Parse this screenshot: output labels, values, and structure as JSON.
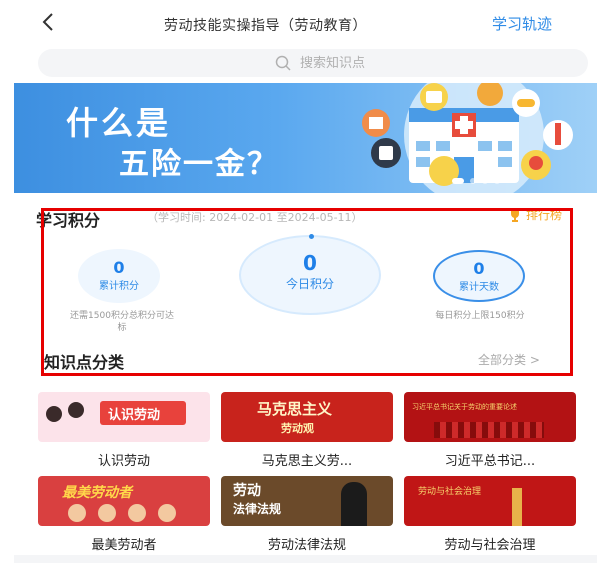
{
  "header": {
    "title": "劳动技能实操指导（劳动教育）",
    "history": "学习轨迹"
  },
  "search": {
    "placeholder": "搜索知识点"
  },
  "banner": {
    "line1": "什么是",
    "line2": "五险一金？"
  },
  "points": {
    "title": "学习积分",
    "period": "（学习时间: 2024-02-01 至2024-05-11）",
    "ranking": "排行榜",
    "items": [
      {
        "value": "0",
        "label": "累计积分",
        "note": "还需1500积分总积分可达标"
      },
      {
        "value": "0",
        "label": "今日积分",
        "note": ""
      },
      {
        "value": "0",
        "label": "累计天数",
        "note": "每日积分上限150积分"
      }
    ]
  },
  "categories": {
    "title": "知识点分类",
    "all": "全部分类 >",
    "items": [
      {
        "label": "认识劳动",
        "thumb_text": "认识劳动",
        "color": "#fce3ea"
      },
      {
        "label": "马克思主义劳...",
        "thumb_text": "马克思主义",
        "thumb_sub": "劳动观",
        "color": "#c8231c"
      },
      {
        "label": "习近平总书记...",
        "thumb_text": "习近平总书记关于劳动的重要论述",
        "color": "#b31214"
      },
      {
        "label": "最美劳动者",
        "thumb_text": "最美劳动者",
        "color": "#d94040"
      },
      {
        "label": "劳动法律法规",
        "thumb_text": "劳动",
        "thumb_sub": "法律法规",
        "color": "#6b4a2a"
      },
      {
        "label": "劳动与社会治理",
        "thumb_text": "劳动与社会治理",
        "color": "#c01616"
      }
    ]
  },
  "colors": {
    "accent": "#2f8be6",
    "highlight_box": "#e60000"
  }
}
